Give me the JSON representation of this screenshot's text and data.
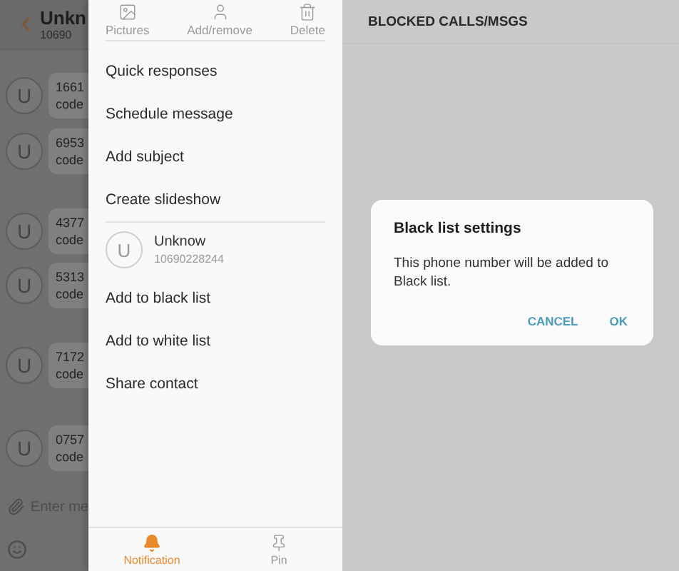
{
  "thread": {
    "title": "Unkn",
    "number": "10690",
    "input_placeholder": "Enter me",
    "messages": [
      {
        "avatar": "U",
        "lines": [
          "1661",
          "code"
        ]
      },
      {
        "avatar": "U",
        "lines": [
          "6953",
          "code"
        ]
      },
      {
        "avatar": "U",
        "lines": [
          "4377",
          "code"
        ]
      },
      {
        "avatar": "U",
        "lines": [
          "5313",
          "code"
        ]
      },
      {
        "avatar": "U",
        "lines": [
          "7172",
          "code"
        ]
      },
      {
        "avatar": "U",
        "lines": [
          "0757",
          "code"
        ]
      }
    ]
  },
  "drawer": {
    "actions": [
      {
        "kind": "pictures",
        "label": "Pictures"
      },
      {
        "kind": "contact",
        "label": "Add/remove"
      },
      {
        "kind": "delete",
        "label": "Delete"
      }
    ],
    "menu_top": [
      "Quick responses",
      "Schedule message",
      "Add subject",
      "Create slideshow"
    ],
    "contact": {
      "avatar": "U",
      "name": "Unknow",
      "number": "10690228244"
    },
    "menu_bottom": [
      "Add to black list",
      "Add to white list",
      "Share contact"
    ],
    "bottom_tabs": [
      {
        "kind": "notification",
        "label": "Notification",
        "selected": true
      },
      {
        "kind": "pin",
        "label": "Pin",
        "selected": false
      }
    ]
  },
  "blocked": {
    "title": "BLOCKED CALLS/MSGS",
    "dialog": {
      "title": "Black list settings",
      "message": "This phone number will be added to Black list.",
      "buttons": [
        "CANCEL",
        "OK"
      ]
    }
  }
}
